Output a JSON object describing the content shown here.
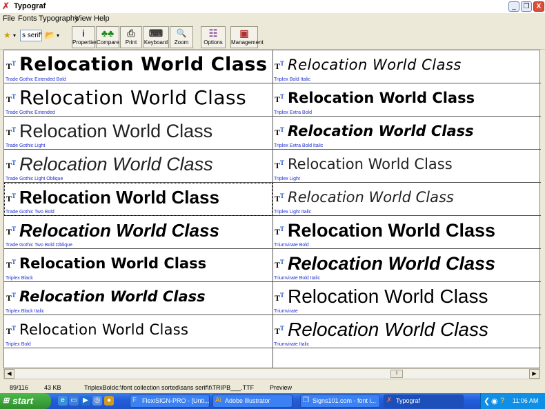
{
  "window": {
    "title": "Typograf",
    "controls": {
      "minimize": "_",
      "restore": "❐",
      "close": "X"
    }
  },
  "menu": [
    "File",
    "Fonts",
    "Typography",
    "View",
    "Help"
  ],
  "toolbar": {
    "filter_value": "s serif\\t",
    "buttons": [
      {
        "label": "Properties",
        "icon": "info-icon",
        "glyph": "i",
        "color": "#1a3fd0"
      },
      {
        "label": "Compare",
        "icon": "compare-icon",
        "glyph": "♣♣",
        "color": "#1a8a1a"
      },
      {
        "label": "Print",
        "icon": "printer-icon",
        "glyph": "⎙",
        "color": "#555555"
      },
      {
        "label": "Keyboard",
        "icon": "keyboard-icon",
        "glyph": "⌨",
        "color": "#333333"
      },
      {
        "label": "Zoom",
        "icon": "zoom-icon",
        "glyph": "🔍",
        "color": "#1a3fd0"
      },
      {
        "label": "Options",
        "icon": "options-icon",
        "glyph": "☷",
        "color": "#8a3fa0"
      },
      {
        "label": "Management",
        "icon": "management-icon",
        "glyph": "▣",
        "color": "#b03030"
      }
    ]
  },
  "sample_text": "Relocation World Class",
  "fonts": {
    "left": [
      {
        "name": "Trade Gothic Extended Bold"
      },
      {
        "name": "Trade Gothic Extended"
      },
      {
        "name": "Trade Gothic Light"
      },
      {
        "name": "Trade Gothic Light Oblique"
      },
      {
        "name": "Trade Gothic Two Bold"
      },
      {
        "name": "Trade Gothic Two Bold Oblique"
      },
      {
        "name": "Triplex Black"
      },
      {
        "name": "Triplex Black Italic"
      },
      {
        "name": "Triplex Bold"
      }
    ],
    "right": [
      {
        "name": "Triplex Bold Italic"
      },
      {
        "name": "Triplex Extra Bold"
      },
      {
        "name": "Triplex Extra Bold Italic"
      },
      {
        "name": "Triplex Light"
      },
      {
        "name": "Triplex Light Italic"
      },
      {
        "name": "Triumvirate Bold"
      },
      {
        "name": "Triumvirate Bold Italic"
      },
      {
        "name": "Triumvirate"
      },
      {
        "name": "Triumvirate Italic"
      }
    ]
  },
  "status": {
    "count": "89/116",
    "size": "43 KB",
    "font": "TriplexBold",
    "path": "c:\\font collection sorted\\sans serif\\t\\TRIPB___.TTF",
    "mode": "Preview"
  },
  "taskbar": {
    "start_label": "start",
    "tasks": [
      {
        "label": "FlexiSIGN-PRO - [Unti..."
      },
      {
        "label": "Adobe Illustrator"
      },
      {
        "label": "Signs101.com - font i..."
      },
      {
        "label": "Typograf"
      }
    ],
    "clock": "11:06 AM"
  }
}
